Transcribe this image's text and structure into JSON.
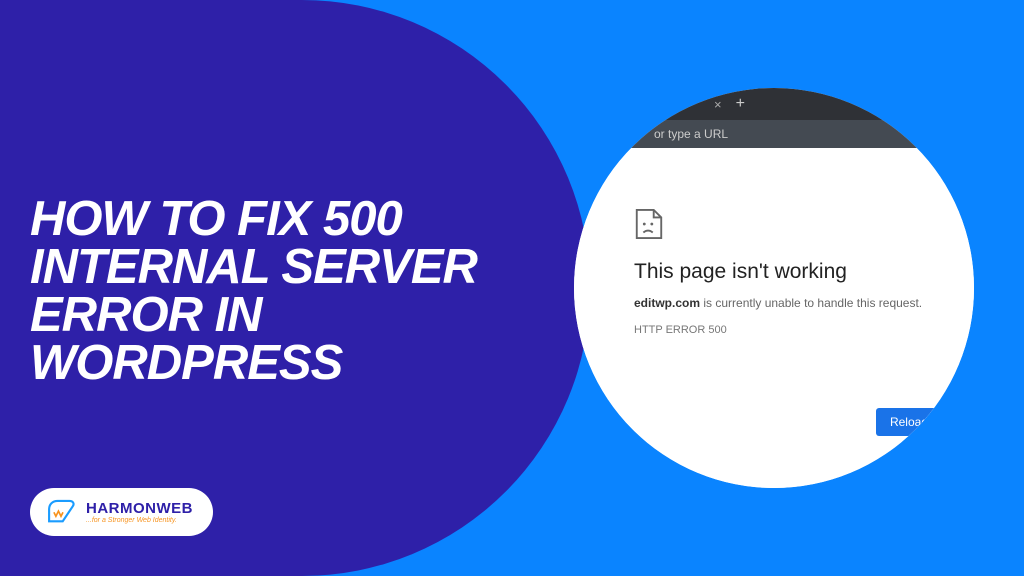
{
  "heading": "HOW TO FIX 500\nINTERNAL SERVER\nERROR IN\nWORDPRESS",
  "brand": {
    "name": "HARMONWEB",
    "tagline": "...for a Stronger Web Identity."
  },
  "browser": {
    "url_hint": "or type a URL",
    "tab_close": "×",
    "tab_new": "+"
  },
  "error": {
    "title": "This page isn't working",
    "domain": "editwp.com",
    "desc_suffix": " is currently unable to handle this request.",
    "code": "HTTP ERROR 500",
    "reload": "Reload"
  }
}
